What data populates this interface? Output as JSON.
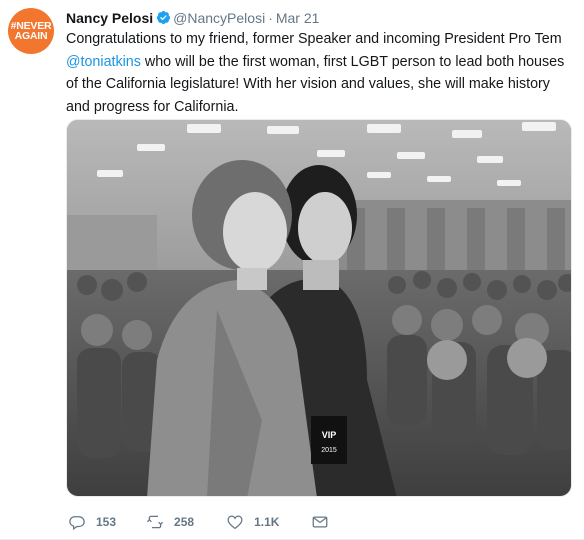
{
  "tweet": {
    "avatar_lines": [
      "#NEVER",
      "AGAIN"
    ],
    "author_name": "Nancy Pelosi",
    "verified": true,
    "handle": "@NancyPelosi",
    "separator": "·",
    "date": "Mar 21",
    "text_part1": "Congratulations to my friend, former Speaker and incoming President Pro Tem ",
    "mention": "@toniatkins",
    "text_part2": " who will be the first woman, first LGBT person to lead both houses of the California legislature! With her vision and values, she will make history and progress for California.",
    "media": {
      "type": "photo",
      "style": "black-and-white",
      "sign_text_1": "VIP",
      "sign_text_2": "2015"
    },
    "actions": {
      "reply_count": "153",
      "retweet_count": "258",
      "like_count": "1.1K"
    }
  },
  "colors": {
    "avatar_bg": "#f2762e",
    "verified_blue": "#1da1f2",
    "link_blue": "#1b95e0",
    "muted_text": "#657786",
    "body_text": "#14171a"
  },
  "icons": [
    "verified-badge-icon",
    "reply-icon",
    "retweet-icon",
    "like-icon",
    "direct-message-icon"
  ]
}
